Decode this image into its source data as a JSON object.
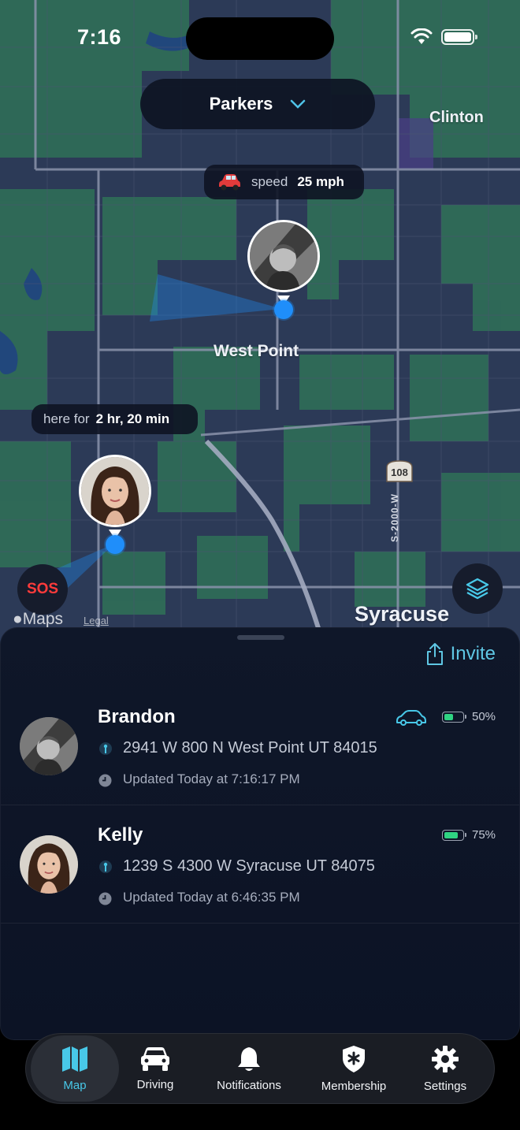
{
  "status_bar": {
    "time": "7:16"
  },
  "group_selector": {
    "label": "Parkers"
  },
  "map": {
    "labels": {
      "clinton": "Clinton",
      "west_point": "West Point",
      "syracuse": "Syracuse"
    },
    "road_shield": "108",
    "road_name": "S-2000-W",
    "speed_bubble": {
      "label": "speed",
      "value": "25 mph"
    },
    "dwell_bubble": {
      "label": "here for",
      "value": "2 hr, 20 min"
    },
    "sos_label": "SOS",
    "attribution": {
      "brand": "Maps",
      "legal": "Legal"
    }
  },
  "sheet": {
    "invite_label": "Invite",
    "members": [
      {
        "name": "Brandon",
        "address": "2941 W 800 N West Point UT 84015",
        "updated": "Updated Today at 7:16:17 PM",
        "battery": "50%",
        "battery_level": 0.5,
        "driving": true
      },
      {
        "name": "Kelly",
        "address": "1239 S 4300 W Syracuse UT 84075",
        "updated": "Updated Today at 6:46:35 PM",
        "battery": "75%",
        "battery_level": 0.75,
        "driving": false
      }
    ]
  },
  "tabs": [
    {
      "label": "Map",
      "icon": "map-icon",
      "active": true
    },
    {
      "label": "Driving",
      "icon": "car-icon",
      "active": false
    },
    {
      "label": "Notifications",
      "icon": "bell-icon",
      "active": false
    },
    {
      "label": "Membership",
      "icon": "shield-star-icon",
      "active": false
    },
    {
      "label": "Settings",
      "icon": "gear-icon",
      "active": false
    }
  ],
  "colors": {
    "accent": "#48c8e8",
    "location_dot": "#1f8efa",
    "sos": "#ff3b3b",
    "battery_fill": "#2fd382"
  }
}
